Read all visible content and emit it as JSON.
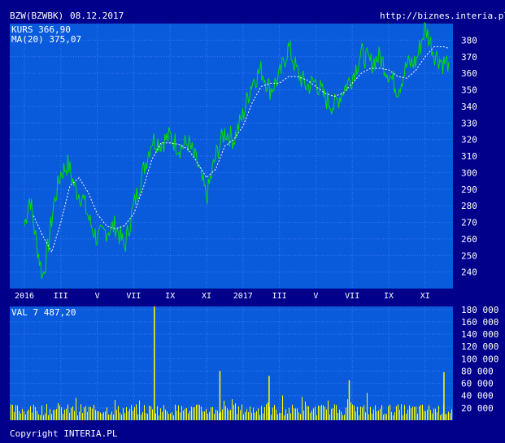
{
  "header": {
    "ticker": "BZW(BZWBK)",
    "date": "08.12.2017",
    "source": "http://biznes.interia.pl"
  },
  "footer": {
    "copyright": "Copyright INTERIA.PL"
  },
  "colors": {
    "background": "#00008b",
    "plot": "#0a5adc",
    "grid": "#3b7cf0",
    "price": "#00e000",
    "ma": "#ffffff",
    "volume": "#ffff00",
    "legend_price": "#00ff00",
    "legend_text": "#ffffff"
  },
  "chart_data": [
    {
      "type": "line",
      "legend": {
        "price": "KURS 366,90",
        "ma": "MA(20) 375,07"
      },
      "ylim": [
        230,
        390
      ],
      "yticks": [
        "240",
        "250",
        "260",
        "270",
        "280",
        "290",
        "300",
        "310",
        "320",
        "330",
        "340",
        "350",
        "360",
        "370",
        "380"
      ],
      "xticks": [
        "2016",
        "III",
        "V",
        "VII",
        "IX",
        "XI",
        "2017",
        "III",
        "V",
        "VII",
        "IX",
        "XI"
      ],
      "series": [
        {
          "name": "KURS",
          "x_month": [
            0,
            0.3,
            0.6,
            1.0,
            1.3,
            1.6,
            2.0,
            2.4,
            2.8,
            3.2,
            3.6,
            4.0,
            4.5,
            5.0,
            5.5,
            6.0,
            6.5,
            7.0,
            7.5,
            8.0,
            8.5,
            9.0,
            9.5,
            10.0,
            10.5,
            11.0,
            11.5,
            12.0,
            12.5,
            13.0,
            13.5,
            14.0,
            14.5,
            15.0,
            15.5,
            16.0,
            16.5,
            17.0,
            17.5,
            18.0,
            18.5,
            19.0,
            19.5,
            20.0,
            20.5,
            21.0,
            21.5,
            22.0,
            22.5,
            23.0,
            23.3
          ],
          "values": [
            268,
            286,
            262,
            237,
            255,
            280,
            300,
            305,
            290,
            285,
            270,
            260,
            265,
            268,
            255,
            280,
            300,
            320,
            318,
            322,
            315,
            318,
            305,
            285,
            310,
            325,
            320,
            335,
            355,
            362,
            350,
            358,
            376,
            360,
            352,
            355,
            345,
            340,
            350,
            358,
            372,
            366,
            370,
            360,
            350,
            365,
            367,
            388,
            372,
            366,
            366.9
          ]
        },
        {
          "name": "MA(20)",
          "x_month": [
            0.5,
            1.0,
            1.5,
            2.0,
            2.5,
            3.0,
            3.5,
            4.0,
            4.5,
            5.0,
            5.5,
            6.0,
            6.5,
            7.0,
            7.5,
            8.0,
            8.5,
            9.0,
            9.5,
            10.0,
            10.5,
            11.0,
            11.5,
            12.0,
            12.5,
            13.0,
            13.5,
            14.0,
            14.5,
            15.0,
            15.5,
            16.0,
            16.5,
            17.0,
            17.5,
            18.0,
            18.5,
            19.0,
            19.5,
            20.0,
            20.5,
            21.0,
            21.5,
            22.0,
            22.5,
            23.0,
            23.3
          ],
          "values": [
            274,
            262,
            252,
            270,
            292,
            297,
            288,
            275,
            268,
            266,
            268,
            275,
            290,
            308,
            318,
            318,
            317,
            314,
            306,
            297,
            302,
            316,
            320,
            328,
            342,
            352,
            354,
            354,
            358,
            358,
            356,
            352,
            348,
            346,
            348,
            354,
            360,
            363,
            363,
            362,
            358,
            357,
            362,
            370,
            376,
            376,
            375.07
          ]
        }
      ]
    },
    {
      "type": "bar",
      "legend": "VAL 7 487,20",
      "ylim": [
        0,
        185000
      ],
      "yticks": [
        "20 000",
        "40 000",
        "60 000",
        "80 000",
        "100 000",
        "120 000",
        "140 000",
        "160 000",
        "180 000"
      ],
      "series": [
        {
          "name": "VAL",
          "spikes_month": [
            7.1,
            10.7,
            13.4,
            17.8,
            23.0
          ],
          "spike_values": [
            185000,
            80000,
            72000,
            65000,
            78000
          ]
        }
      ]
    }
  ]
}
